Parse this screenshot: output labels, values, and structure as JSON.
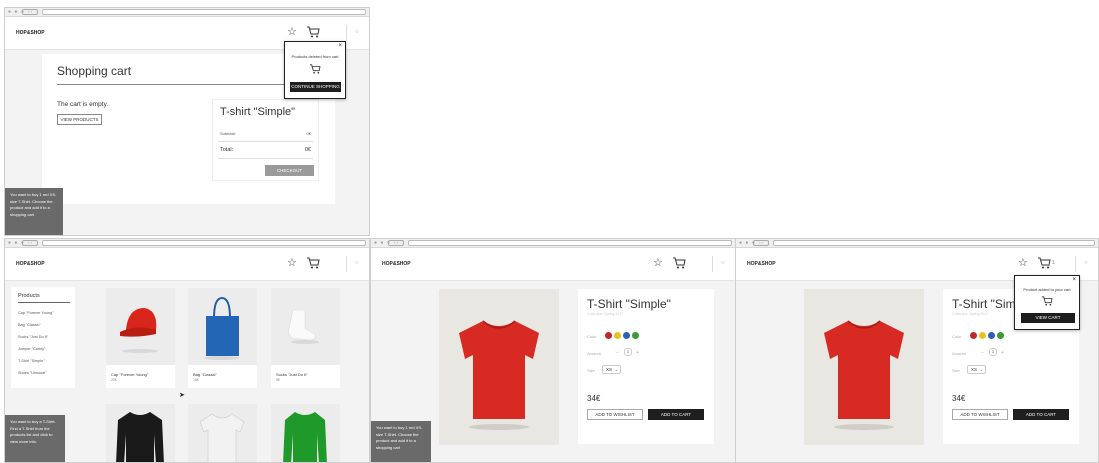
{
  "shop": {
    "logo": "HOP&SHOP",
    "star_icon": "star-icon",
    "cart_icon": "cart-icon",
    "search_icon": "search-icon",
    "cart_count": "1"
  },
  "task": {
    "cart_window": "You want to buy 1 red XS-size T-Shirt. Choose the product and add it to a shopping cart",
    "products_window": "You want to buy a T-Shirt. Find a T-Shirt from the products list and click to view more info.",
    "product_window": "You want to buy 1 red XS-size T-Shirt. Choose the product and add it to a shopping cart"
  },
  "cart": {
    "title": "Shopping cart",
    "empty": "The cart is empty.",
    "view_products": "VIEW PRODUCTS",
    "product_name": "T-shirt \"Simple\"",
    "subtotal_label": "Subtotal:",
    "subtotal_value": "0€",
    "total_label": "Total:",
    "total_value": "0€",
    "checkout": "CHECKOUT"
  },
  "popup_deleted": {
    "message": "Products deleted from cart",
    "button": "CONTINUE SHOPPING"
  },
  "popup_added": {
    "message": "Product added to your cart",
    "button": "VIEW CART"
  },
  "products": {
    "sidebar_title": "Products",
    "sidebar_items": [
      "Cap \"Forever Young\"",
      "Bag \"Classic\"",
      "Socks \"Just Do It\"",
      "Jumper \"Comfy\"",
      "T-Shirt \"Simple\"",
      "Shoes \"Unusual\""
    ],
    "tiles": [
      {
        "name": "Cap \"Forever Young\"",
        "price": "20€"
      },
      {
        "name": "Bag \"Classic\"",
        "price": "15€"
      },
      {
        "name": "Socks \"Just Do It\"",
        "price": "5€"
      }
    ]
  },
  "product": {
    "title": "T-Shirt \"Simple\"",
    "subtitle": "Collection: Spring 2017",
    "color_label": "Color",
    "colors": [
      "#c0272d",
      "#e8c21e",
      "#2d5fb8",
      "#3a9a3a"
    ],
    "amount_label": "Amount",
    "amount_minus": "−",
    "amount_value": "1",
    "amount_plus": "+",
    "size_label": "Size",
    "size_value": "XS",
    "price": "34€",
    "wishlist": "ADD TO WISHLIST",
    "add_to_cart": "ADD TO CART"
  },
  "window": {
    "dots": "● ● ●",
    "nav": "‹ ›"
  }
}
